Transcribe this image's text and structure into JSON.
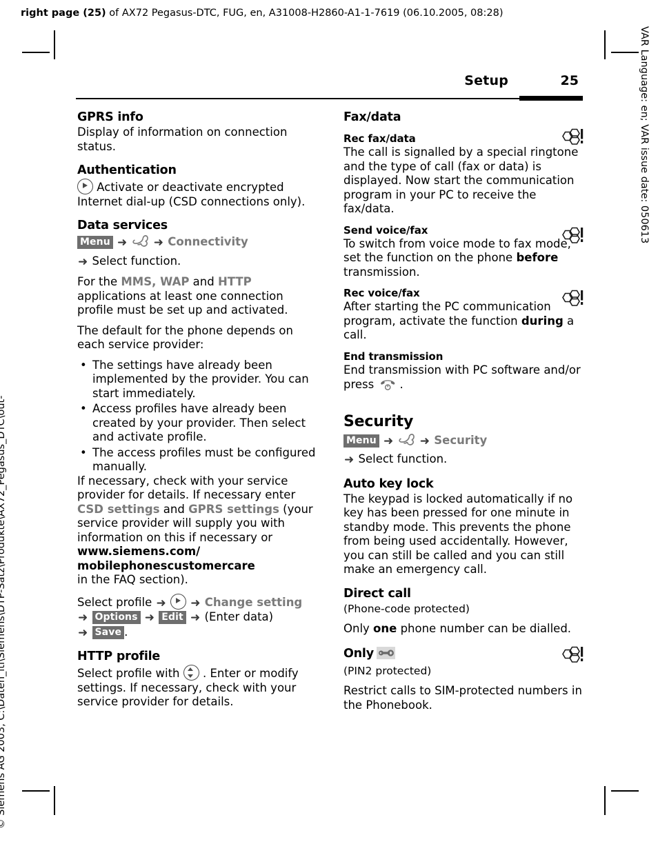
{
  "page": {
    "header_bold": "right page (25)",
    "header_rest": " of AX72 Pegasus-DTC, FUG, en, A31008-H2860-A1-1-7619 (06.10.2005, 08:28)",
    "side_right": "VAR Language: en; VAR issue date: 050613",
    "side_left": "© Siemens AG 2003, C:\\Daten_itl\\Siemens\\DTP-Satz\\Produkte\\AX72_Pegasus_DTC\\out-",
    "running_head": "Setup",
    "page_number": "25"
  },
  "left_column": {
    "gprs_info": {
      "title": "GPRS info",
      "body": "Display of information on connection status."
    },
    "authentication": {
      "title": "Authentication",
      "body": "Activate or deactivate encrypted Internet dial-up (CSD connections only)."
    },
    "data_services": {
      "title": "Data services",
      "nav": {
        "softkey": "Menu",
        "arrow": "➜",
        "menu_item": "Connectivity",
        "select": "Select function."
      },
      "p1_pre": "For the ",
      "p1_mms": "MMS",
      "p1_sep1": ", ",
      "p1_wap": "WAP",
      "p1_sep2": " and ",
      "p1_http": "HTTP",
      "p1_post": " applications at least one connection profile must be set up and activated.",
      "p2": "The default for the phone depends on each service provider:",
      "bullets": [
        "The settings have already been implemented by the provider. You can start immediately.",
        "Access profiles have already been created by your provider. Then select and activate profile.",
        "The access profiles must be configured manually."
      ],
      "p3_pre": "If necessary, check with your service provider for details. If necessary enter ",
      "p3_csd": "CSD settings",
      "p3_mid": " and ",
      "p3_gprs": "GPRS settings",
      "p3_post": " (your service provider will supply you with information on this if necessary or ",
      "url_line1": "www.siemens.com/",
      "url_line2": "mobilephonescustomercare",
      "p3_end": "in the FAQ section).",
      "steps": {
        "select_profile": "Select profile",
        "change_setting": "Change setting",
        "options": "Options",
        "edit": "Edit",
        "enter_data": "(Enter data)",
        "save": "Save",
        "period": "."
      }
    },
    "http_profile": {
      "title": "HTTP profile",
      "body_pre": "Select profile with ",
      "body_post": ". Enter or modify settings. If necessary, check with your service provider for details."
    }
  },
  "right_column": {
    "fax_data": {
      "title": "Fax/data",
      "rec_fax_data": {
        "title": "Rec fax/data",
        "body": "The call is signalled by a special ringtone and the type of call (fax or data) is displayed. Now start the communication program in your PC to receive the fax/data."
      },
      "send_voice_fax": {
        "title": "Send voice/fax",
        "body_pre": "To switch from voice mode to fax mode, set the function on the phone ",
        "body_bold": "before",
        "body_post": " transmission."
      },
      "rec_voice_fax": {
        "title": "Rec voice/fax",
        "body_pre": "After starting the PC communication program, activate the function ",
        "body_bold": "during",
        "body_post": " a call."
      },
      "end_transmission": {
        "title": "End transmission",
        "body_pre": "End transmission with PC software and/or press ",
        "body_post": "."
      }
    },
    "security": {
      "title": "Security",
      "nav": {
        "softkey": "Menu",
        "menu_item": "Security",
        "select": "Select function."
      },
      "auto_key_lock": {
        "title": "Auto key lock",
        "body": "The keypad is locked automatically if no key has been pressed for one minute in standby mode. This prevents the phone from being used accidentally. However, you can still be called and you can still make an emergency call."
      },
      "direct_call": {
        "title": "Direct call",
        "protection": "(Phone-code protected)",
        "body_pre": "Only ",
        "body_bold": "one",
        "body_post": " phone number can be dialled."
      },
      "only": {
        "title": "Only",
        "protection": "(PIN2 protected)",
        "body": "Restrict calls to SIM-protected numbers in the Phonebook."
      }
    }
  },
  "icons": {
    "nav_right": "nav-key-right-icon",
    "nav_updown": "nav-key-updown-icon",
    "hand_menu": "hand-pointer-icon",
    "network_dependent": "network-operator-flag-icon",
    "end_call": "end-call-key-icon",
    "sim_key": "sim-key-icon"
  },
  "colors": {
    "text": "#000000",
    "ui_term_grey": "#7a7a7a",
    "softkey_bg": "#6e6e6e",
    "softkey_fg": "#ffffff"
  }
}
